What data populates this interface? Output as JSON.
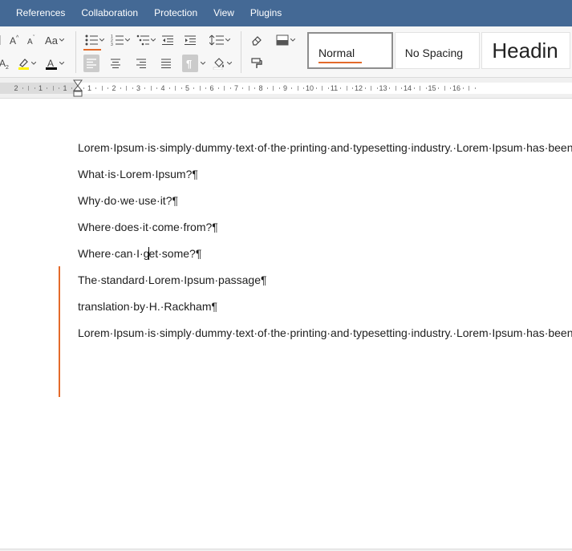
{
  "menu": [
    "References",
    "Collaboration",
    "Protection",
    "View",
    "Plugins"
  ],
  "toolbar": {
    "change_case_label": "Aa",
    "styles": [
      {
        "label": "Normal",
        "font_size": 14,
        "selected": true
      },
      {
        "label": "No Spacing",
        "font_size": 14,
        "selected": false
      },
      {
        "label": "Headin",
        "font_size": 26,
        "selected": false
      }
    ],
    "colors": {
      "highlight": "#fff200",
      "font_color": "#000000",
      "accent": "#e36a2a"
    }
  },
  "ruler": {
    "labels": [
      "2",
      "1",
      "1",
      "1",
      "2",
      "3",
      "4",
      "5",
      "6",
      "7",
      "8",
      "9",
      "10",
      "11",
      "12",
      "13",
      "14",
      "15",
      "16"
    ]
  },
  "document": {
    "paragraph_1": "Lorem·Ipsum·is·simply·dummy·text·of·the·printing·and·typesetting·industry.·Lorem·Ipsum·has·been·the·industry's·standard·dummy·text·ever·since·the·1500s,·when·an·unknown·printer·took·a·galley·of·type·and·scrambled·it·to·make·a·type·specimen·book.·It·has·survived·not·only·five·centuries,·but·also·the·leap·into·electronic·typesetting,·remaining·essentially·unchanged.·It·was·popularised·in·the·1960s·with·the·release·of·Letraset·sheets·containing·Lorem·Ipsum·passages,·and·more·recently·with·desktop·publishing·software·like·Aldus·PageMaker·including·versions·of·Lorem·Ipsum.¶",
    "lines": [
      "What·is·Lorem·Ipsum?¶",
      "Why·do·we·use·it?¶",
      "Where·does·it·come·from?¶",
      "The·standard·Lorem·Ipsum·passage¶",
      "translation·by·H.·Rackham¶"
    ],
    "cursor_line_before": "Where·can·I·g",
    "cursor_line_after": "et·some?¶",
    "paragraph_2": "Lorem·Ipsum·is·simply·dummy·text·of·the·printing·and·typesetting·industry.·Lorem·Ipsum·has·been·the·industry's·standard·dummy·text·ever·since·the·1500s,·when·an·unknown·printer·took·a·galley·of·type·and·scrambled·it·to·make·a·type·specimen·book.·It·has·survived·not·only·five·centuries,·but·also·the·leap·into·electronic·typesetting,·remaining·essentially·unchanged.·It·was·popularised·in·the·1960s·with·the·release·of·Letraset·sheets·containing·Lorem·Ipsum·passages,·and·more·recently·with·desktop·publishing·software·like·Aldus·PageMaker·including·versions·of·Lorem·Ipsum.¶"
  }
}
